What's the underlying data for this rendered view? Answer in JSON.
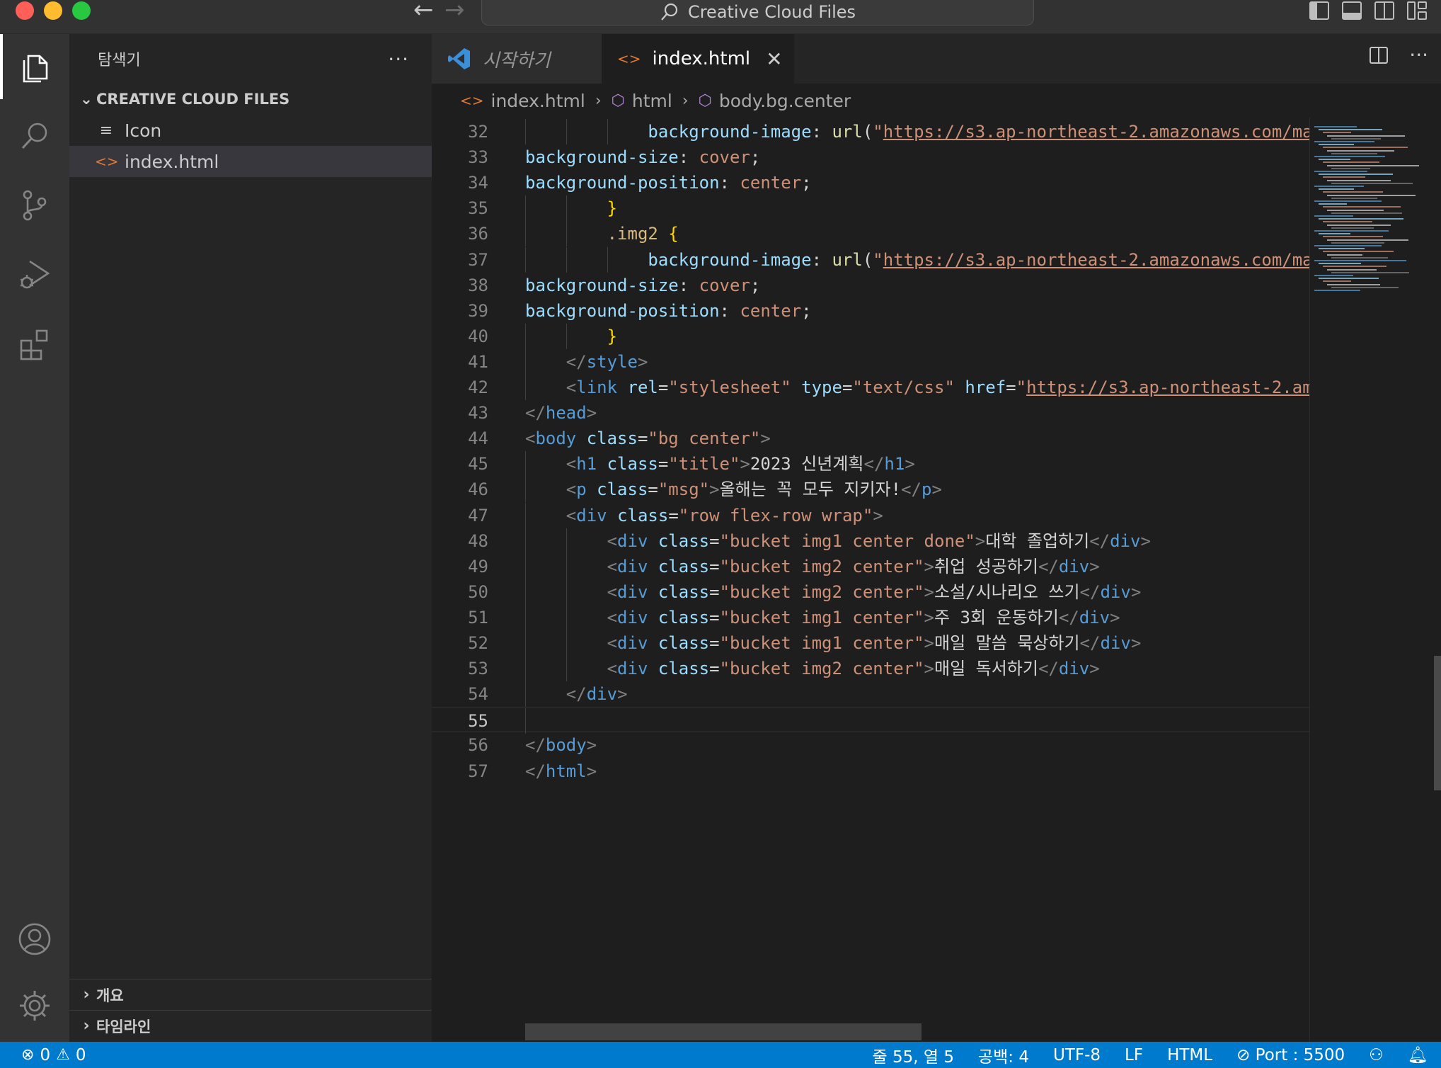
{
  "window": {
    "title": "Creative Cloud Files"
  },
  "explorer": {
    "title": "탐색기",
    "more": "···",
    "folder": "CREATIVE CLOUD FILES",
    "files": [
      {
        "name": "Icon",
        "icon": "lines-icon"
      },
      {
        "name": "index.html",
        "icon": "html-icon"
      }
    ],
    "outline": "개요",
    "timeline": "타임라인"
  },
  "tabs": [
    {
      "label": "시작하기",
      "icon": "vscode-logo-icon",
      "active": false
    },
    {
      "label": "index.html",
      "icon": "html-icon",
      "active": true
    }
  ],
  "breadcrumb": [
    "index.html",
    "html",
    "body.bg.center"
  ],
  "editor": {
    "current_line": 55,
    "lines": [
      {
        "n": "32",
        "indent": 3,
        "tokens": [
          [
            "t-prop",
            "background-image"
          ],
          [
            "t-punc",
            ": "
          ],
          [
            "t-fn",
            "url"
          ],
          [
            "t-punc",
            "("
          ],
          [
            "t-str",
            "\""
          ],
          [
            "t-url",
            "https://s3.ap-northeast-2.amazonaws.com/ma"
          ]
        ]
      },
      {
        "n": "33",
        "indent": 0,
        "tokens": [
          [
            "t-prop",
            "background-size"
          ],
          [
            "t-punc",
            ": "
          ],
          [
            "t-val",
            "cover"
          ],
          [
            "t-punc",
            ";"
          ]
        ]
      },
      {
        "n": "34",
        "indent": 0,
        "tokens": [
          [
            "t-prop",
            "background-position"
          ],
          [
            "t-punc",
            ": "
          ],
          [
            "t-val",
            "center"
          ],
          [
            "t-punc",
            ";"
          ]
        ]
      },
      {
        "n": "35",
        "indent": 2,
        "tokens": [
          [
            "t-brace",
            "}"
          ]
        ]
      },
      {
        "n": "36",
        "indent": 2,
        "tokens": [
          [
            "t-sel",
            ".img2"
          ],
          [
            "t-punc",
            " "
          ],
          [
            "t-brace",
            "{"
          ]
        ]
      },
      {
        "n": "37",
        "indent": 3,
        "tokens": [
          [
            "t-prop",
            "background-image"
          ],
          [
            "t-punc",
            ": "
          ],
          [
            "t-fn",
            "url"
          ],
          [
            "t-punc",
            "("
          ],
          [
            "t-str",
            "\""
          ],
          [
            "t-url",
            "https://s3.ap-northeast-2.amazonaws.com/ma"
          ]
        ]
      },
      {
        "n": "38",
        "indent": 0,
        "tokens": [
          [
            "t-prop",
            "background-size"
          ],
          [
            "t-punc",
            ": "
          ],
          [
            "t-val",
            "cover"
          ],
          [
            "t-punc",
            ";"
          ]
        ]
      },
      {
        "n": "39",
        "indent": 0,
        "tokens": [
          [
            "t-prop",
            "background-position"
          ],
          [
            "t-punc",
            ": "
          ],
          [
            "t-val",
            "center"
          ],
          [
            "t-punc",
            ";"
          ]
        ]
      },
      {
        "n": "40",
        "indent": 2,
        "tokens": [
          [
            "t-brace",
            "}"
          ]
        ]
      },
      {
        "n": "41",
        "indent": 1,
        "tokens": [
          [
            "t-br",
            "</"
          ],
          [
            "t-tag",
            "style"
          ],
          [
            "t-br",
            ">"
          ]
        ]
      },
      {
        "n": "42",
        "indent": 1,
        "tokens": [
          [
            "t-br",
            "<"
          ],
          [
            "t-tag",
            "link"
          ],
          [
            "t-punc",
            " "
          ],
          [
            "t-attr",
            "rel"
          ],
          [
            "t-punc",
            "="
          ],
          [
            "t-str",
            "\"stylesheet\""
          ],
          [
            "t-punc",
            " "
          ],
          [
            "t-attr",
            "type"
          ],
          [
            "t-punc",
            "="
          ],
          [
            "t-str",
            "\"text/css\""
          ],
          [
            "t-punc",
            " "
          ],
          [
            "t-attr",
            "href"
          ],
          [
            "t-punc",
            "="
          ],
          [
            "t-str",
            "\""
          ],
          [
            "t-url",
            "https://s3.ap-northeast-2.am"
          ]
        ]
      },
      {
        "n": "43",
        "indent": 0,
        "tokens": [
          [
            "t-br",
            "</"
          ],
          [
            "t-tag",
            "head"
          ],
          [
            "t-br",
            ">"
          ]
        ]
      },
      {
        "n": "44",
        "indent": 0,
        "tokens": [
          [
            "t-br",
            "<"
          ],
          [
            "t-tag",
            "body"
          ],
          [
            "t-punc",
            " "
          ],
          [
            "t-attr",
            "class"
          ],
          [
            "t-punc",
            "="
          ],
          [
            "t-str",
            "\"bg center\""
          ],
          [
            "t-br",
            ">"
          ]
        ]
      },
      {
        "n": "45",
        "indent": 1,
        "tokens": [
          [
            "t-br",
            "<"
          ],
          [
            "t-tag",
            "h1"
          ],
          [
            "t-punc",
            " "
          ],
          [
            "t-attr",
            "class"
          ],
          [
            "t-punc",
            "="
          ],
          [
            "t-str",
            "\"title\""
          ],
          [
            "t-br",
            ">"
          ],
          [
            "t-txt",
            "2023 신년계획"
          ],
          [
            "t-br",
            "</"
          ],
          [
            "t-tag",
            "h1"
          ],
          [
            "t-br",
            ">"
          ]
        ]
      },
      {
        "n": "46",
        "indent": 1,
        "tokens": [
          [
            "t-br",
            "<"
          ],
          [
            "t-tag",
            "p"
          ],
          [
            "t-punc",
            " "
          ],
          [
            "t-attr",
            "class"
          ],
          [
            "t-punc",
            "="
          ],
          [
            "t-str",
            "\"msg\""
          ],
          [
            "t-br",
            ">"
          ],
          [
            "t-txt",
            "올해는 꼭 모두 지키자!"
          ],
          [
            "t-br",
            "</"
          ],
          [
            "t-tag",
            "p"
          ],
          [
            "t-br",
            ">"
          ]
        ]
      },
      {
        "n": "47",
        "indent": 1,
        "tokens": [
          [
            "t-br",
            "<"
          ],
          [
            "t-tag",
            "div"
          ],
          [
            "t-punc",
            " "
          ],
          [
            "t-attr",
            "class"
          ],
          [
            "t-punc",
            "="
          ],
          [
            "t-str",
            "\"row flex-row wrap\""
          ],
          [
            "t-br",
            ">"
          ]
        ]
      },
      {
        "n": "48",
        "indent": 2,
        "tokens": [
          [
            "t-br",
            "<"
          ],
          [
            "t-tag",
            "div"
          ],
          [
            "t-punc",
            " "
          ],
          [
            "t-attr",
            "class"
          ],
          [
            "t-punc",
            "="
          ],
          [
            "t-str",
            "\"bucket img1 center done\""
          ],
          [
            "t-br",
            ">"
          ],
          [
            "t-txt",
            "대학 졸업하기"
          ],
          [
            "t-br",
            "</"
          ],
          [
            "t-tag",
            "div"
          ],
          [
            "t-br",
            ">"
          ]
        ]
      },
      {
        "n": "49",
        "indent": 2,
        "tokens": [
          [
            "t-br",
            "<"
          ],
          [
            "t-tag",
            "div"
          ],
          [
            "t-punc",
            " "
          ],
          [
            "t-attr",
            "class"
          ],
          [
            "t-punc",
            "="
          ],
          [
            "t-str",
            "\"bucket img2 center\""
          ],
          [
            "t-br",
            ">"
          ],
          [
            "t-txt",
            "취업 성공하기"
          ],
          [
            "t-br",
            "</"
          ],
          [
            "t-tag",
            "div"
          ],
          [
            "t-br",
            ">"
          ]
        ]
      },
      {
        "n": "50",
        "indent": 2,
        "tokens": [
          [
            "t-br",
            "<"
          ],
          [
            "t-tag",
            "div"
          ],
          [
            "t-punc",
            " "
          ],
          [
            "t-attr",
            "class"
          ],
          [
            "t-punc",
            "="
          ],
          [
            "t-str",
            "\"bucket img2 center\""
          ],
          [
            "t-br",
            ">"
          ],
          [
            "t-txt",
            "소설/시나리오 쓰기"
          ],
          [
            "t-br",
            "</"
          ],
          [
            "t-tag",
            "div"
          ],
          [
            "t-br",
            ">"
          ]
        ]
      },
      {
        "n": "51",
        "indent": 2,
        "tokens": [
          [
            "t-br",
            "<"
          ],
          [
            "t-tag",
            "div"
          ],
          [
            "t-punc",
            " "
          ],
          [
            "t-attr",
            "class"
          ],
          [
            "t-punc",
            "="
          ],
          [
            "t-str",
            "\"bucket img1 center\""
          ],
          [
            "t-br",
            ">"
          ],
          [
            "t-txt",
            "주 3회 운동하기"
          ],
          [
            "t-br",
            "</"
          ],
          [
            "t-tag",
            "div"
          ],
          [
            "t-br",
            ">"
          ]
        ]
      },
      {
        "n": "52",
        "indent": 2,
        "tokens": [
          [
            "t-br",
            "<"
          ],
          [
            "t-tag",
            "div"
          ],
          [
            "t-punc",
            " "
          ],
          [
            "t-attr",
            "class"
          ],
          [
            "t-punc",
            "="
          ],
          [
            "t-str",
            "\"bucket img1 center\""
          ],
          [
            "t-br",
            ">"
          ],
          [
            "t-txt",
            "매일 말씀 묵상하기"
          ],
          [
            "t-br",
            "</"
          ],
          [
            "t-tag",
            "div"
          ],
          [
            "t-br",
            ">"
          ]
        ]
      },
      {
        "n": "53",
        "indent": 2,
        "tokens": [
          [
            "t-br",
            "<"
          ],
          [
            "t-tag",
            "div"
          ],
          [
            "t-punc",
            " "
          ],
          [
            "t-attr",
            "class"
          ],
          [
            "t-punc",
            "="
          ],
          [
            "t-str",
            "\"bucket img2 center\""
          ],
          [
            "t-br",
            ">"
          ],
          [
            "t-txt",
            "매일 독서하기"
          ],
          [
            "t-br",
            "</"
          ],
          [
            "t-tag",
            "div"
          ],
          [
            "t-br",
            ">"
          ]
        ]
      },
      {
        "n": "54",
        "indent": 1,
        "tokens": [
          [
            "t-br",
            "</"
          ],
          [
            "t-tag",
            "div"
          ],
          [
            "t-br",
            ">"
          ]
        ]
      },
      {
        "n": "55",
        "indent": 0,
        "tokens": []
      },
      {
        "n": "56",
        "indent": 0,
        "tokens": [
          [
            "t-br",
            "</"
          ],
          [
            "t-tag",
            "body"
          ],
          [
            "t-br",
            ">"
          ]
        ]
      },
      {
        "n": "57",
        "indent": 0,
        "tokens": [
          [
            "t-br",
            "</"
          ],
          [
            "t-tag",
            "html"
          ],
          [
            "t-br",
            ">"
          ]
        ]
      }
    ]
  },
  "statusbar": {
    "errors": "0",
    "warnings": "0",
    "position": "줄 55, 열 5",
    "spaces": "공백: 4",
    "encoding": "UTF-8",
    "eol": "LF",
    "language": "HTML",
    "port": "Port : 5500"
  },
  "colors": {
    "accent": "#007acc",
    "html_icon": "#e37933",
    "tag": "#569cd6",
    "attribute": "#9cdcfe",
    "string": "#ce9178"
  }
}
